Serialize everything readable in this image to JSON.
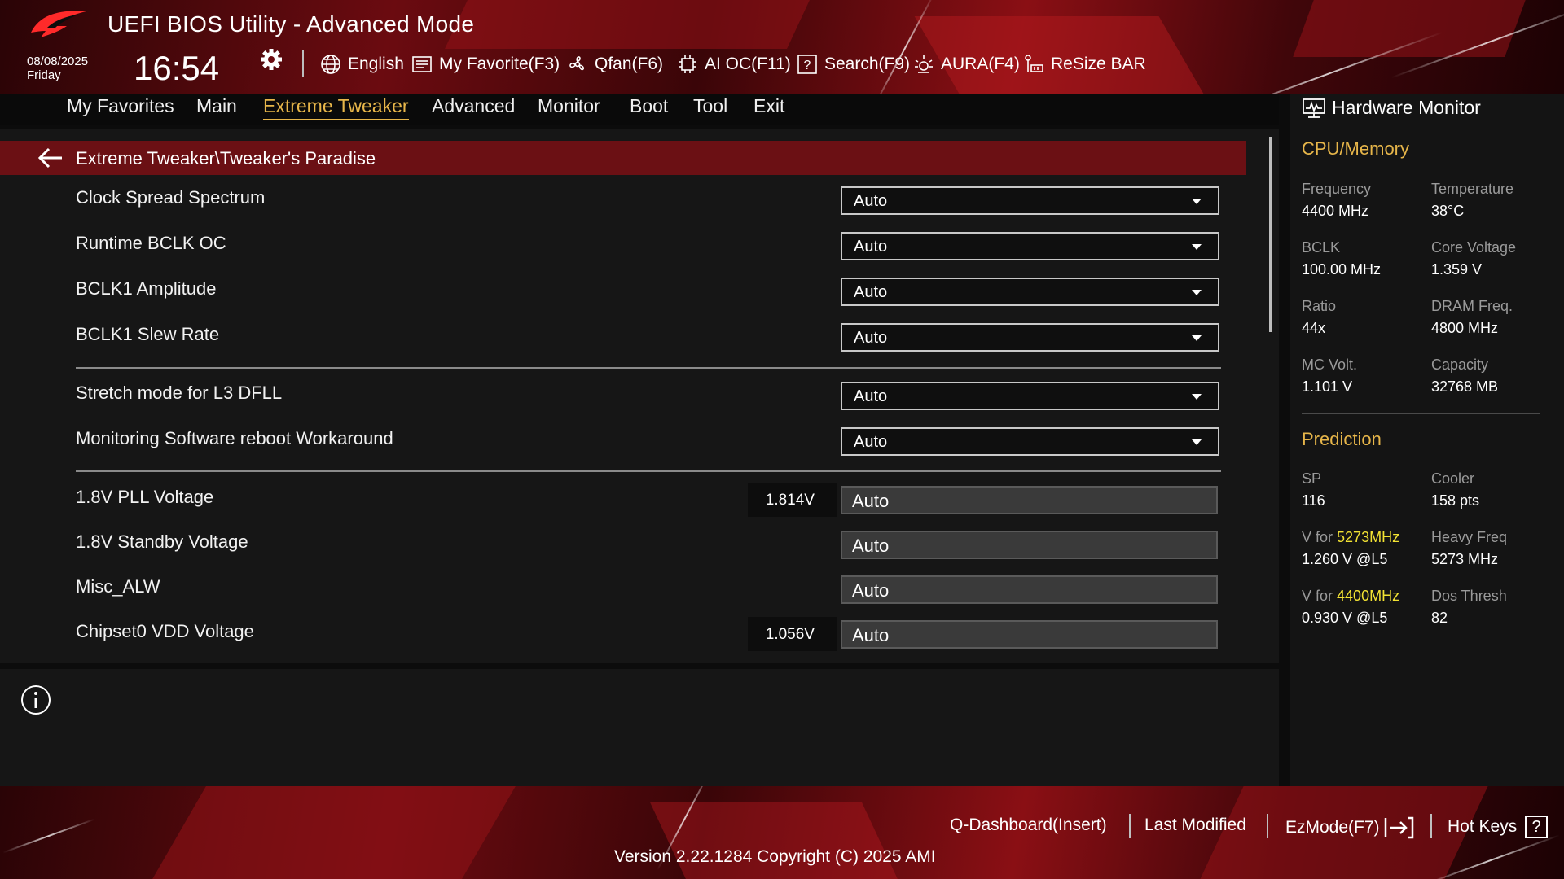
{
  "header": {
    "title": "UEFI BIOS Utility - Advanced Mode",
    "date": "08/08/2025",
    "day": "Friday",
    "time": "16:54"
  },
  "toolbar": {
    "language": "English",
    "my_favorite": "My Favorite(F3)",
    "qfan": "Qfan(F6)",
    "ai_oc": "AI OC(F11)",
    "search": "Search(F9)",
    "aura": "AURA(F4)",
    "resize_bar": "ReSize BAR"
  },
  "menu": {
    "items": [
      "My Favorites",
      "Main",
      "Extreme Tweaker",
      "Advanced",
      "Monitor",
      "Boot",
      "Tool",
      "Exit"
    ],
    "active": "Extreme Tweaker"
  },
  "breadcrumb": "Extreme Tweaker\\Tweaker's Paradise",
  "settings": [
    {
      "label": "Clock Spread Spectrum",
      "value": "Auto"
    },
    {
      "label": "Runtime BCLK OC",
      "value": "Auto"
    },
    {
      "label": "BCLK1 Amplitude",
      "value": "Auto"
    },
    {
      "label": "BCLK1 Slew Rate",
      "value": "Auto"
    },
    {
      "label": "Stretch mode for L3 DFLL",
      "value": "Auto"
    },
    {
      "label": "Monitoring Software reboot Workaround",
      "value": "Auto"
    },
    {
      "label": "1.8V PLL Voltage",
      "reading": "1.814V",
      "value": "Auto"
    },
    {
      "label": "1.8V Standby Voltage",
      "value": "Auto"
    },
    {
      "label": "Misc_ALW",
      "value": "Auto"
    },
    {
      "label": "Chipset0 VDD Voltage",
      "reading": "1.056V",
      "value": "Auto"
    }
  ],
  "hardware_monitor": {
    "title": "Hardware Monitor",
    "cpu_memory": {
      "section": "CPU/Memory",
      "frequency_label": "Frequency",
      "frequency": "4400 MHz",
      "temperature_label": "Temperature",
      "temperature": "38°C",
      "bclk_label": "BCLK",
      "bclk": "100.00 MHz",
      "core_voltage_label": "Core Voltage",
      "core_voltage": "1.359 V",
      "ratio_label": "Ratio",
      "ratio": "44x",
      "dram_freq_label": "DRAM Freq.",
      "dram_freq": "4800 MHz",
      "mc_volt_label": "MC Volt.",
      "mc_volt": "1.101 V",
      "capacity_label": "Capacity",
      "capacity": "32768 MB"
    },
    "prediction": {
      "section": "Prediction",
      "sp_label": "SP",
      "sp": "116",
      "cooler_label": "Cooler",
      "cooler": "158 pts",
      "v_for_label": "V for",
      "freq_1": "5273MHz",
      "v_1": "1.260 V @L5",
      "heavy_freq_label": "Heavy Freq",
      "heavy_freq": "5273 MHz",
      "freq_2": "4400MHz",
      "v_2": "0.930 V @L5",
      "dos_thresh_label": "Dos Thresh",
      "dos_thresh": "82"
    }
  },
  "footer": {
    "q_dashboard": "Q-Dashboard(Insert)",
    "last_modified": "Last Modified",
    "ezmode": "EzMode(F7)",
    "hot_keys": "Hot Keys",
    "hot_keys_glyph": "?",
    "version": "Version 2.22.1284 Copyright (C) 2025 AMI"
  },
  "colors": {
    "accent": "#e7b64a",
    "highlight": "#f2e233",
    "breadcrumb_bg": "#6b1014",
    "header_red": "#8a0f14"
  }
}
